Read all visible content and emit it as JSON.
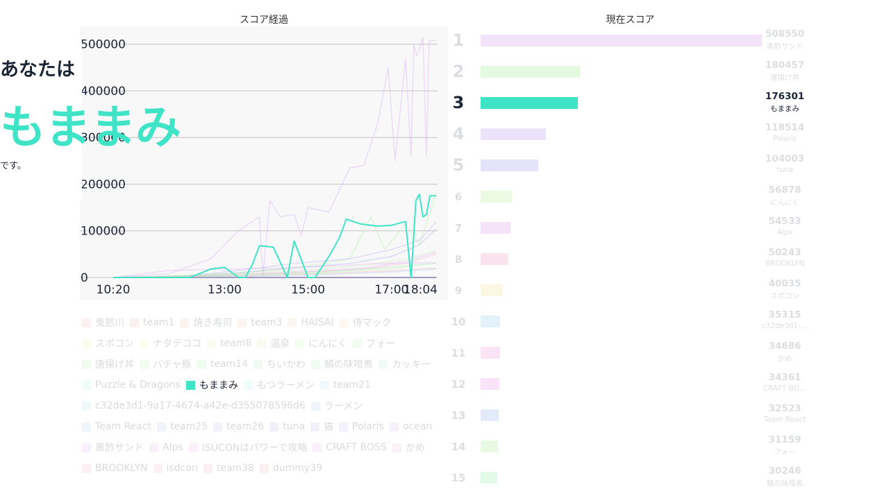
{
  "hero": {
    "you_label": "あなたは",
    "team_name": "もままみ",
    "suffix": "です。"
  },
  "chart_data": [
    {
      "type": "line",
      "title": "スコア経過",
      "x_tick_labels": [
        "10:20",
        "13:00",
        "15:00",
        "17:00",
        "18:04"
      ],
      "x_tick_minutes": [
        620,
        780,
        900,
        1020,
        1084
      ],
      "xlim": [
        620,
        1084
      ],
      "ylim": [
        0,
        510000
      ],
      "y_ticks": [
        0,
        100000,
        200000,
        300000,
        400000,
        500000
      ],
      "grid": true,
      "legend_position": "bottom",
      "highlighted_series": "もままみ",
      "series": [
        {
          "name": "もままみ",
          "color": "#3fe3c6",
          "x": [
            620,
            700,
            730,
            760,
            780,
            800,
            810,
            820,
            830,
            850,
            870,
            880,
            900,
            910,
            930,
            945,
            955,
            975,
            1000,
            1020,
            1040,
            1048,
            1055,
            1060,
            1065,
            1070,
            1075,
            1080,
            1084
          ],
          "y": [
            0,
            0,
            0,
            18000,
            22000,
            0,
            0,
            28000,
            68000,
            65000,
            0,
            78000,
            0,
            0,
            45000,
            85000,
            125000,
            115000,
            110000,
            112000,
            120000,
            0,
            165000,
            178000,
            130000,
            135000,
            175000,
            175000,
            175000
          ]
        },
        {
          "name": "黒酢サンド",
          "color": "#d6a8f0",
          "x": [
            620,
            700,
            760,
            800,
            830,
            835,
            845,
            860,
            880,
            890,
            900,
            930,
            960,
            980,
            1000,
            1015,
            1025,
            1040,
            1048,
            1052,
            1056,
            1060,
            1065,
            1070,
            1074,
            1076,
            1080,
            1084
          ],
          "y": [
            0,
            8000,
            40000,
            100000,
            130000,
            0,
            165000,
            130000,
            135000,
            90000,
            150000,
            140000,
            235000,
            240000,
            330000,
            450000,
            250000,
            470000,
            260000,
            500000,
            475000,
            490000,
            515000,
            260000,
            508000,
            508000,
            508000,
            508550
          ]
        },
        {
          "name": "唐揚げ丼",
          "color": "#a8f0a0",
          "x": [
            620,
            700,
            800,
            900,
            960,
            990,
            1010,
            1040,
            1060,
            1084
          ],
          "y": [
            0,
            3000,
            10000,
            25000,
            40000,
            130000,
            60000,
            115000,
            70000,
            180457
          ]
        },
        {
          "name": "Polaris",
          "color": "#c0a8f0",
          "x": [
            620,
            720,
            800,
            880,
            960,
            1020,
            1060,
            1084
          ],
          "y": [
            0,
            3000,
            15000,
            30000,
            40000,
            60000,
            80000,
            118514
          ]
        },
        {
          "name": "tuna",
          "color": "#a8a8f0",
          "x": [
            620,
            720,
            800,
            880,
            960,
            1020,
            1060,
            1084
          ],
          "y": [
            0,
            2000,
            10000,
            20000,
            30000,
            45000,
            70000,
            104003
          ]
        },
        {
          "name": "にんにく",
          "color": "#c8f0a8",
          "x": [
            620,
            760,
            880,
            980,
            1040,
            1084
          ],
          "y": [
            0,
            5000,
            15000,
            25000,
            40000,
            56878
          ]
        },
        {
          "name": "Alps",
          "color": "#e0a8f0",
          "x": [
            620,
            760,
            880,
            980,
            1040,
            1084
          ],
          "y": [
            0,
            4000,
            12000,
            20000,
            35000,
            54533
          ]
        },
        {
          "name": "BROOKLYN",
          "color": "#f0a8c8",
          "x": [
            620,
            760,
            880,
            980,
            1040,
            1084
          ],
          "y": [
            0,
            3000,
            10000,
            18000,
            30000,
            50243
          ]
        },
        {
          "name": "ISUCONはパワーで攻略",
          "color": "#e8a8f0",
          "x": [
            620,
            700,
            780,
            860,
            940,
            1000,
            1084
          ],
          "y": [
            0,
            15000,
            18000,
            20000,
            25000,
            30000,
            32000
          ]
        },
        {
          "name": "team1",
          "color": "#f0b0a8",
          "x": [
            620,
            800,
            920,
            1020,
            1084
          ],
          "y": [
            0,
            3000,
            8000,
            15000,
            20000
          ]
        },
        {
          "name": "ラーメン",
          "color": "#a8c8f0",
          "x": [
            620,
            800,
            920,
            1020,
            1084
          ],
          "y": [
            0,
            2000,
            6000,
            12000,
            18000
          ]
        },
        {
          "name": "フォー",
          "color": "#b8f0a8",
          "x": [
            620,
            800,
            920,
            1020,
            1084
          ],
          "y": [
            0,
            5000,
            12000,
            22000,
            31159
          ]
        },
        {
          "name": "鯖の味噌煮",
          "color": "#a8f0b8",
          "x": [
            620,
            800,
            920,
            1020,
            1084
          ],
          "y": [
            0,
            4000,
            10000,
            20000,
            30246
          ]
        }
      ]
    },
    {
      "type": "bar",
      "title": "現在スコア",
      "highlighted_rank": 3,
      "ranking": [
        {
          "rank": "1",
          "score": "508550",
          "team": "黒酢サンド",
          "color": "#d6a8f0"
        },
        {
          "rank": "2",
          "score": "180457",
          "team": "唐揚げ丼",
          "color": "#a8f0a0"
        },
        {
          "rank": "3",
          "score": "176301",
          "team": "もままみ",
          "color": "#3fe3c6"
        },
        {
          "rank": "4",
          "score": "118514",
          "team": "Polaris",
          "color": "#c0a8f0"
        },
        {
          "rank": "5",
          "score": "104003",
          "team": "tuna",
          "color": "#a8a8f0"
        },
        {
          "rank": "6",
          "score": "56878",
          "team": "にんにく",
          "color": "#c8f0a8"
        },
        {
          "rank": "7",
          "score": "54533",
          "team": "Alps",
          "color": "#e0a8f0"
        },
        {
          "rank": "8",
          "score": "50243",
          "team": "BROOKLYN",
          "color": "#f0a8c8"
        },
        {
          "rank": "9",
          "score": "40035",
          "team": "スポコン",
          "color": "#f0e8a8"
        },
        {
          "rank": "10",
          "score": "35315",
          "team": "c32de3d1-…",
          "color": "#a8d8f0"
        },
        {
          "rank": "11",
          "score": "34686",
          "team": "かめ",
          "color": "#f0a8e0"
        },
        {
          "rank": "12",
          "score": "34361",
          "team": "CRAFT BO…",
          "color": "#f0a8e8"
        },
        {
          "rank": "13",
          "score": "32523",
          "team": "Team React",
          "color": "#a8c0f0"
        },
        {
          "rank": "14",
          "score": "31159",
          "team": "フォー",
          "color": "#b8f0a8"
        },
        {
          "rank": "15",
          "score": "30246",
          "team": "鯖の味噌煮",
          "color": "#a8f0b8"
        }
      ]
    }
  ],
  "legend": [
    {
      "name": "鬼怒川",
      "color": "#f0a8a8"
    },
    {
      "name": "team1",
      "color": "#f0b0a8"
    },
    {
      "name": "焼き寿司",
      "color": "#f0b8a8"
    },
    {
      "name": "team3",
      "color": "#f0c0a8"
    },
    {
      "name": "HAISAI",
      "color": "#f0c8a8"
    },
    {
      "name": "侍マック",
      "color": "#f0d8a8"
    },
    {
      "name": "スポコン",
      "color": "#f0e8a8"
    },
    {
      "name": "ナタデココ",
      "color": "#eef0a8"
    },
    {
      "name": "team8",
      "color": "#e0f0a8"
    },
    {
      "name": "温泉",
      "color": "#d0f0a8"
    },
    {
      "name": "にんにく",
      "color": "#c8f0a8"
    },
    {
      "name": "フォー",
      "color": "#b8f0a8"
    },
    {
      "name": "唐揚げ丼",
      "color": "#a8f0a0"
    },
    {
      "name": "バチャ豚",
      "color": "#a8f098"
    },
    {
      "name": "team14",
      "color": "#a8f0a8"
    },
    {
      "name": "ちいかわ",
      "color": "#a8f0b0"
    },
    {
      "name": "鯖の味噌煮",
      "color": "#a8f0b8"
    },
    {
      "name": "カッキー",
      "color": "#a8f0c8"
    },
    {
      "name": "Puzzle & Dragons",
      "color": "#a8f0d8"
    },
    {
      "name": "もままみ",
      "color": "#3fe3c6"
    },
    {
      "name": "もつラーメン",
      "color": "#a8f0f0"
    },
    {
      "name": "team21",
      "color": "#a8e0f0"
    },
    {
      "name": "c32de3d1-9a17-4674-a42e-d355078596d6",
      "color": "#a8d8f0"
    },
    {
      "name": "ラーメン",
      "color": "#a8c8f0"
    },
    {
      "name": "Team React",
      "color": "#a8c0f0"
    },
    {
      "name": "team25",
      "color": "#a8b8f0"
    },
    {
      "name": "team26",
      "color": "#a8b0f0"
    },
    {
      "name": "tuna",
      "color": "#a8a8f0"
    },
    {
      "name": "猫",
      "color": "#b0a8f0"
    },
    {
      "name": "Polaris",
      "color": "#c0a8f0"
    },
    {
      "name": "ocean",
      "color": "#c8a8f0"
    },
    {
      "name": "黒酢サンド",
      "color": "#d6a8f0"
    },
    {
      "name": "Alps",
      "color": "#e0a8f0"
    },
    {
      "name": "ISUCONはパワーで攻略",
      "color": "#e8a8f0"
    },
    {
      "name": "CRAFT BOSS",
      "color": "#f0a8e8"
    },
    {
      "name": "かめ",
      "color": "#f0a8e0"
    },
    {
      "name": "BROOKLYN",
      "color": "#f0a8c8"
    },
    {
      "name": "isdcon",
      "color": "#f0a8c0"
    },
    {
      "name": "team38",
      "color": "#f0a8b8"
    },
    {
      "name": "dummy39",
      "color": "#f0a8b0"
    }
  ]
}
